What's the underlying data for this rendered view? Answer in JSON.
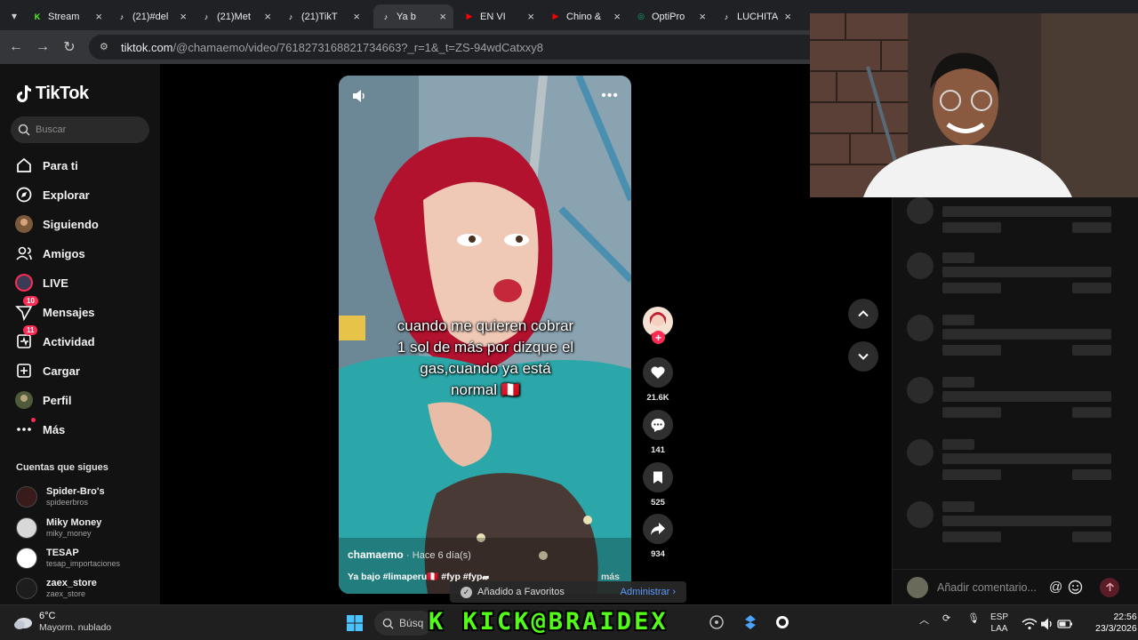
{
  "browser": {
    "tabs": [
      {
        "label": "Stream",
        "icon": "kick-icon",
        "color": "#53fc18",
        "active": false
      },
      {
        "label": "(21)#del",
        "icon": "tiktok-icon",
        "color": "#ffffff",
        "active": false
      },
      {
        "label": "(21)Met",
        "icon": "tiktok-icon",
        "color": "#ffffff",
        "active": false
      },
      {
        "label": "(21)TikT",
        "icon": "tiktok-icon",
        "color": "#ffffff",
        "active": false
      },
      {
        "label": "Ya b",
        "icon": "tiktok-icon",
        "color": "#ffffff",
        "active": true
      },
      {
        "label": "EN VI",
        "icon": "youtube-icon",
        "color": "#ff0000",
        "active": false
      },
      {
        "label": "Chino &",
        "icon": "youtube-icon",
        "color": "#ff0000",
        "active": false
      },
      {
        "label": "OptiPro",
        "icon": "optipro-icon",
        "color": "#19a974",
        "active": false
      },
      {
        "label": "LUCHITA",
        "icon": "tiktok-icon",
        "color": "#ffffff",
        "active": false
      }
    ],
    "url_host": "tiktok.com",
    "url_path": "/@chamaemo/video/7618273168821734663?_r=1&_t=ZS-94wdCatxxy8"
  },
  "sidebar": {
    "logo": "TikTok",
    "search_placeholder": "Buscar",
    "nav": [
      {
        "label": "Para ti",
        "icon": "home-icon"
      },
      {
        "label": "Explorar",
        "icon": "compass-icon"
      },
      {
        "label": "Siguiendo",
        "icon": "following-avatar-icon"
      },
      {
        "label": "Amigos",
        "icon": "friends-icon"
      },
      {
        "label": "LIVE",
        "icon": "live-icon"
      },
      {
        "label": "Mensajes",
        "icon": "messages-icon",
        "badge": "10"
      },
      {
        "label": "Actividad",
        "icon": "activity-icon",
        "badge": "11"
      },
      {
        "label": "Cargar",
        "icon": "upload-icon"
      },
      {
        "label": "Perfil",
        "icon": "profile-avatar-icon"
      },
      {
        "label": "Más",
        "icon": "more-dots-icon"
      }
    ],
    "following_title": "Cuentas que sigues",
    "following": [
      {
        "name": "Spider-Bro's",
        "handle": "spideerbros"
      },
      {
        "name": "Miky Money",
        "handle": "miky_money"
      },
      {
        "name": "TESAP",
        "handle": "tesap_importaciones"
      },
      {
        "name": "zaex_store",
        "handle": "zaex_store"
      }
    ]
  },
  "video": {
    "caption_lines": [
      "cuando me quieren cobrar",
      "1 sol de más por dizque el",
      "gas,cuando ya está",
      "normal 🇵🇪"
    ],
    "author": "chamaemo",
    "when": "· Hace 6 día(s)",
    "description": "Ya bajo #limaperu🇵🇪 #fyp #fyp𝔀",
    "more": "más"
  },
  "actions": {
    "likes": "21.6K",
    "comments": "141",
    "saves": "525",
    "shares": "934"
  },
  "toast": {
    "message": "Añadido a Favoritos",
    "link": "Administrar"
  },
  "comment_input_placeholder": "Añadir comentario...",
  "overlay": {
    "kick_text": "K KICK@BRAIDEX"
  },
  "taskbar": {
    "temp": "6°C",
    "weather": "Mayorm. nublado",
    "search_label": "Búsq",
    "lang_top": "ESP",
    "lang_bottom": "LAA",
    "time": "22:56",
    "date": "23/3/2026"
  },
  "colors": {
    "accent": "#fe2c55",
    "kick": "#53fc18",
    "link": "#5e9bff"
  }
}
